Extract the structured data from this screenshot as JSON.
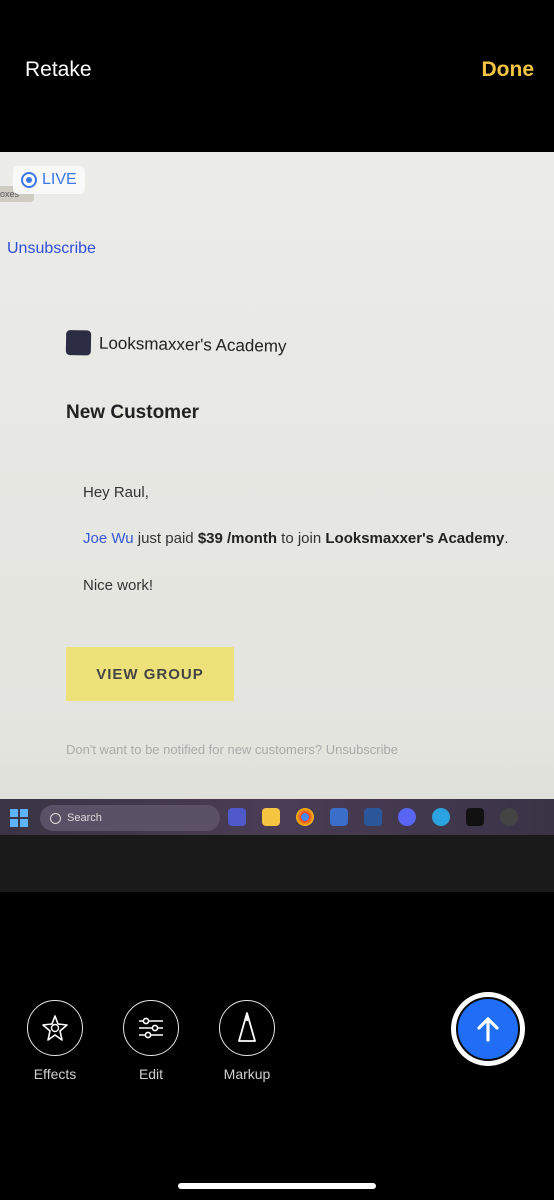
{
  "header": {
    "retake_label": "Retake",
    "done_label": "Done"
  },
  "photo": {
    "live_label": "LIVE",
    "tab_fragment": "oxes",
    "email": {
      "unsubscribe_top": "Unsubscribe",
      "brand_name": "Looksmaxxer's Academy",
      "heading": "New Customer",
      "greeting": "Hey Raul,",
      "customer_name": "Joe Wu",
      "text_paid": " just paid ",
      "amount": "$39 /month",
      "text_join": " to join ",
      "group_name": "Looksmaxxer's Academy",
      "period": ".",
      "closing": "Nice work!",
      "view_group_button": "VIEW GROUP",
      "footer_note": "Don't want to be notified for new customers? Unsubscribe"
    },
    "taskbar": {
      "search_placeholder": "Search"
    }
  },
  "toolbar": {
    "effects_label": "Effects",
    "edit_label": "Edit",
    "markup_label": "Markup"
  },
  "colors": {
    "done": "#f4c542",
    "send": "#1f6ef5",
    "link": "#3557d9",
    "button": "#ede27a"
  }
}
